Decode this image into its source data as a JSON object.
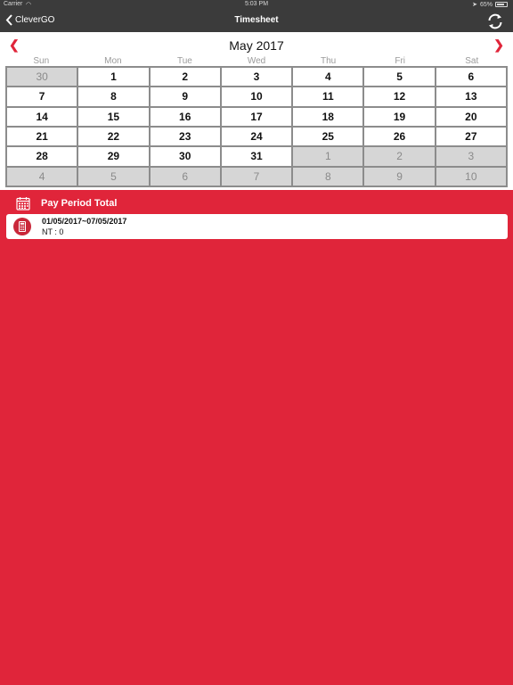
{
  "status": {
    "carrier": "Carrier",
    "time": "5:03 PM",
    "battery": "65%",
    "wifi_icon": "wifi-icon",
    "location_icon": "location-arrow-icon"
  },
  "nav": {
    "back_label": "CleverGO",
    "title": "Timesheet",
    "back_icon": "chevron-left-icon",
    "refresh_icon": "refresh-icon"
  },
  "calendar": {
    "month_title": "May 2017",
    "prev_glyph": "❮",
    "next_glyph": "❯",
    "weekdays": [
      "Sun",
      "Mon",
      "Tue",
      "Wed",
      "Thu",
      "Fri",
      "Sat"
    ],
    "weeks": [
      [
        {
          "d": "30",
          "cur": false
        },
        {
          "d": "1",
          "cur": true
        },
        {
          "d": "2",
          "cur": true
        },
        {
          "d": "3",
          "cur": true
        },
        {
          "d": "4",
          "cur": true
        },
        {
          "d": "5",
          "cur": true
        },
        {
          "d": "6",
          "cur": true
        }
      ],
      [
        {
          "d": "7",
          "cur": true
        },
        {
          "d": "8",
          "cur": true
        },
        {
          "d": "9",
          "cur": true
        },
        {
          "d": "10",
          "cur": true
        },
        {
          "d": "11",
          "cur": true
        },
        {
          "d": "12",
          "cur": true
        },
        {
          "d": "13",
          "cur": true
        }
      ],
      [
        {
          "d": "14",
          "cur": true
        },
        {
          "d": "15",
          "cur": true
        },
        {
          "d": "16",
          "cur": true
        },
        {
          "d": "17",
          "cur": true
        },
        {
          "d": "18",
          "cur": true
        },
        {
          "d": "19",
          "cur": true
        },
        {
          "d": "20",
          "cur": true
        }
      ],
      [
        {
          "d": "21",
          "cur": true
        },
        {
          "d": "22",
          "cur": true
        },
        {
          "d": "23",
          "cur": true
        },
        {
          "d": "24",
          "cur": true
        },
        {
          "d": "25",
          "cur": true
        },
        {
          "d": "26",
          "cur": true
        },
        {
          "d": "27",
          "cur": true
        }
      ],
      [
        {
          "d": "28",
          "cur": true
        },
        {
          "d": "29",
          "cur": true
        },
        {
          "d": "30",
          "cur": true
        },
        {
          "d": "31",
          "cur": true
        },
        {
          "d": "1",
          "cur": false
        },
        {
          "d": "2",
          "cur": false
        },
        {
          "d": "3",
          "cur": false
        }
      ],
      [
        {
          "d": "4",
          "cur": false
        },
        {
          "d": "5",
          "cur": false
        },
        {
          "d": "6",
          "cur": false
        },
        {
          "d": "7",
          "cur": false
        },
        {
          "d": "8",
          "cur": false
        },
        {
          "d": "9",
          "cur": false
        },
        {
          "d": "10",
          "cur": false
        }
      ]
    ]
  },
  "pay_period": {
    "header_title": "Pay Period Total",
    "header_icon": "calendar-icon",
    "entries": [
      {
        "range": "01/05/2017~07/05/2017",
        "summary": "NT : 0",
        "icon": "calculator-icon"
      }
    ]
  },
  "colors": {
    "accent": "#e0253a",
    "navbar": "#3b3b3b",
    "other_month_cell": "#d6d6d6"
  }
}
